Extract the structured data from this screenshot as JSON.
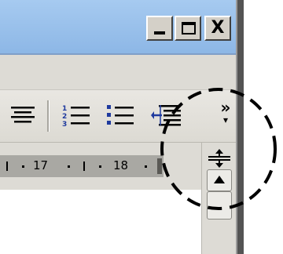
{
  "window": {
    "caption_buttons": {
      "minimize_icon": "minimize-icon",
      "maximize_icon": "maximize-icon",
      "close_glyph": "X"
    },
    "title_bar_color": "#9ec4ee"
  },
  "toolbar": {
    "items": [
      {
        "name": "align-center-icon"
      },
      {
        "name": "numbered-list-icon"
      },
      {
        "name": "bulleted-list-icon"
      },
      {
        "name": "decrease-indent-icon"
      }
    ],
    "overflow_glyph": "»",
    "overflow_arrow": "▾"
  },
  "ruler": {
    "labels": [
      "17",
      "18"
    ]
  },
  "scrollbar": {
    "split_handle_icon": "split-handle-icon",
    "up_arrow_icon": "scroll-up-arrow-icon"
  },
  "callout": {
    "style": "dashed-circle",
    "color": "#000000"
  }
}
